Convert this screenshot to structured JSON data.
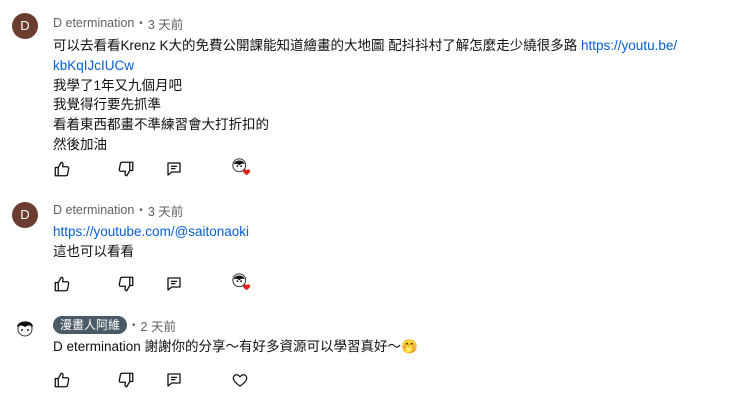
{
  "comments": [
    {
      "avatar_letter": "D",
      "author": "D etermination",
      "time": "3 天前",
      "lines": [
        {
          "text": "可以去看看Krenz  K大的免費公開課能知道繪畫的大地圖 配抖抖村了解怎麼走少繞很多路 ",
          "link": "https://youtu.be/"
        },
        {
          "link": "kbKqIJcIUCw"
        },
        {
          "text": "我學了1年又九個月吧"
        },
        {
          "text": "我覺得行要先抓準"
        },
        {
          "text": "看着東西都畫不準練習會大打折扣的"
        },
        {
          "text": "然後加油"
        }
      ]
    },
    {
      "avatar_letter": "D",
      "author": "D etermination",
      "time": "3 天前",
      "lines": [
        {
          "link": "https://youtube.com/@saitonaoki"
        },
        {
          "text": "這也可以看看"
        }
      ]
    },
    {
      "author": "漫畫人阿維",
      "time": "2 天前",
      "lines": [
        {
          "text": "D etermination 謝謝你的分享～有好多資源可以學習真好～🤭"
        }
      ]
    }
  ],
  "icons": [
    "like-icon",
    "dislike-icon",
    "reply-icon",
    "creator-heart-icon",
    "heart-outline-icon"
  ],
  "colors": {
    "link": "#065fd4",
    "secondary_text": "#606060",
    "badge_bg": "#4a5a66",
    "avatar_bg": "#6b3d2e",
    "heart": "#e5201a"
  }
}
